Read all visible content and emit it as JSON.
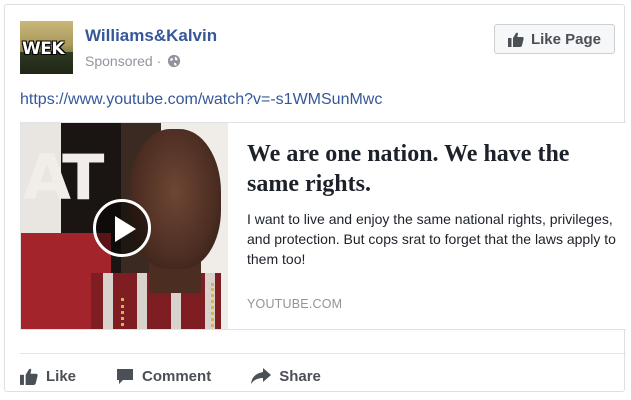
{
  "post": {
    "page_name": "Williams&Kalvin",
    "sponsored_label": "Sponsored ·",
    "avatar_text": "WEK",
    "like_page_label": "Like Page",
    "url": "https://www.youtube.com/watch?v=-s1WMSunMwc"
  },
  "preview": {
    "headline": "We are one nation. We have the same rights.",
    "description": "I want to live and enjoy the same national rights, privileges, and protection. But cops srat to forget that the laws apply to them too!",
    "domain": "YOUTUBE.COM",
    "thumbnail_letters": "AT"
  },
  "actions": {
    "like": "Like",
    "comment": "Comment",
    "share": "Share"
  },
  "icons": {
    "thumbs_up": "thumbs-up-icon",
    "comment": "comment-icon",
    "share": "share-icon",
    "globe": "globe-icon",
    "play": "play-icon"
  },
  "colors": {
    "link_blue": "#365899",
    "muted_gray": "#90949c",
    "action_gray": "#4b4f56"
  }
}
